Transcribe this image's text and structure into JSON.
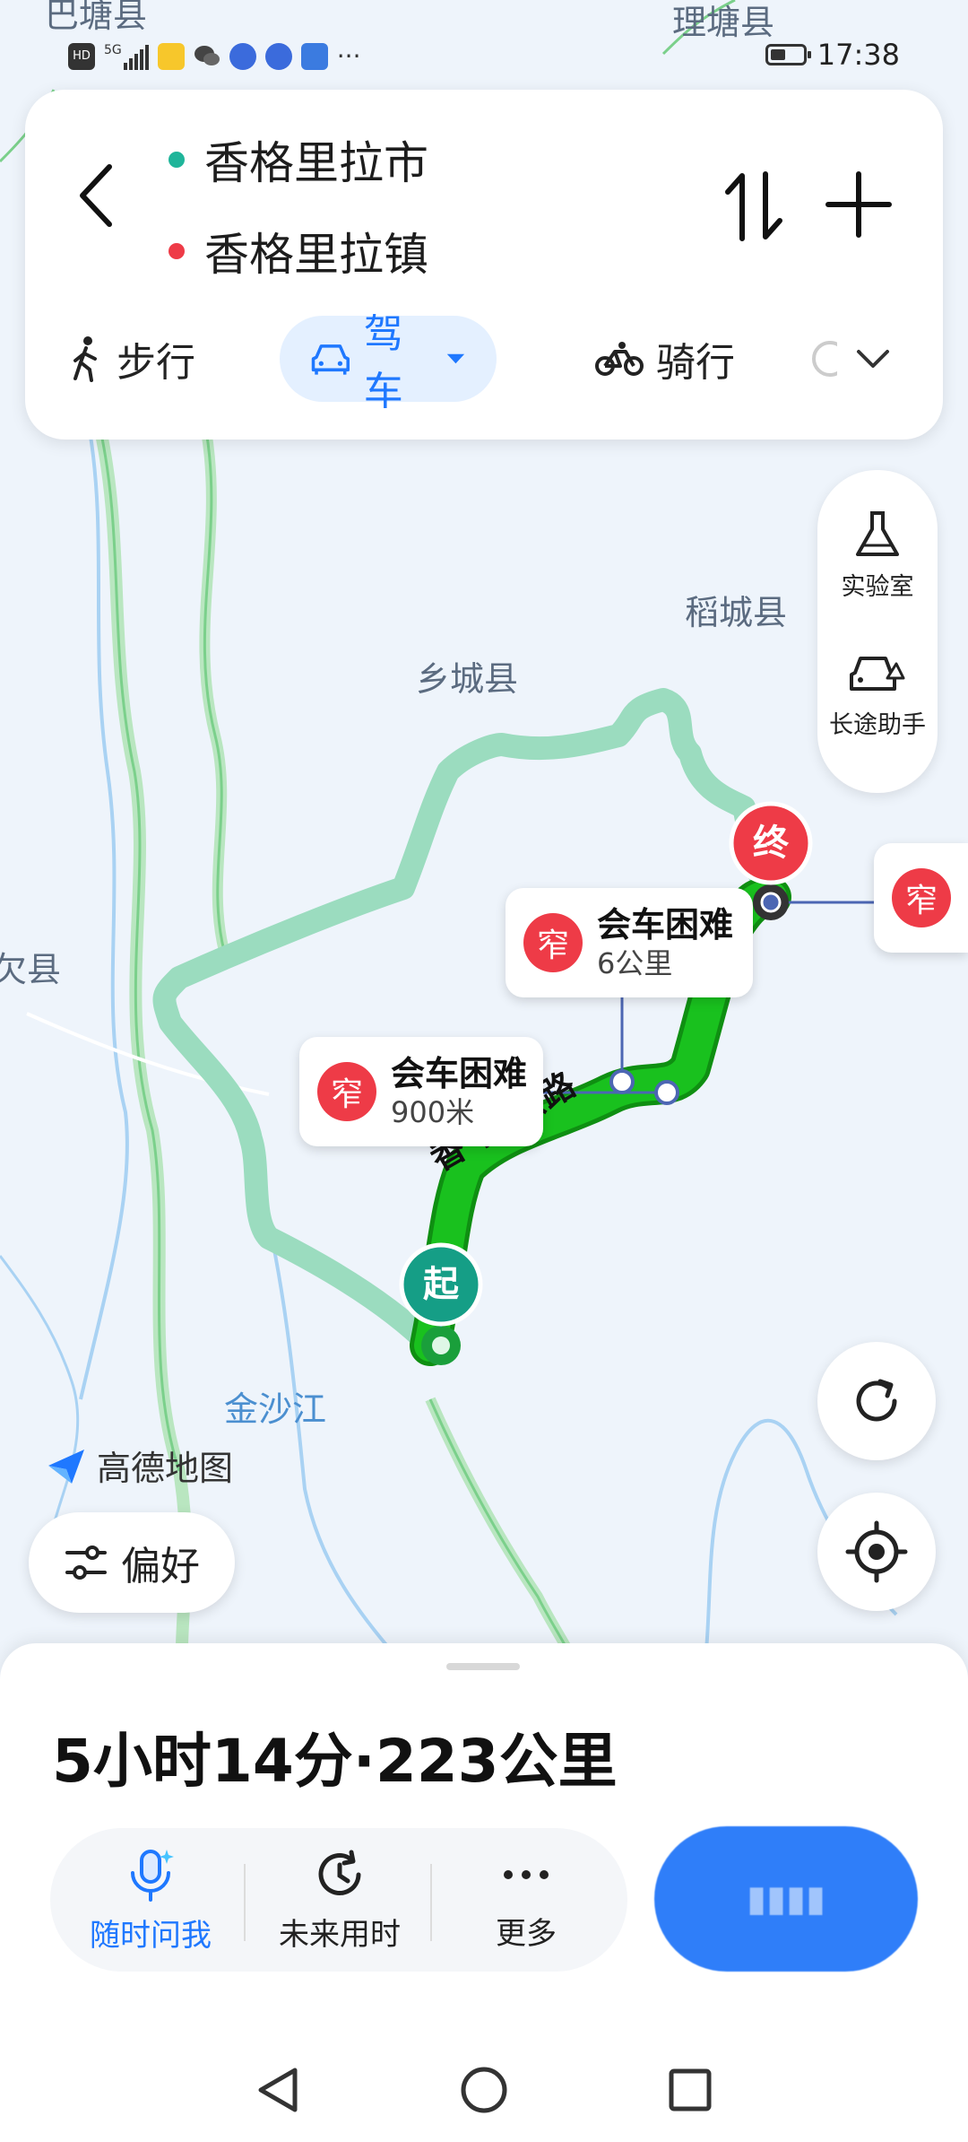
{
  "status_bar": {
    "time": "17:38",
    "network": "5G",
    "hd": "HD",
    "icons": [
      "meituan-icon",
      "wechat-icon",
      "browser-icon",
      "browser2-icon",
      "security-icon",
      "more-dots"
    ]
  },
  "route": {
    "start": "香格里拉市",
    "end": "香格里拉镇",
    "start_color": "#1fb59a",
    "end_color": "#ee3b47"
  },
  "modes": {
    "walk": "步行",
    "drive": "驾车",
    "ride": "骑行"
  },
  "side_tools": {
    "lab": "实验室",
    "long_trip": "长途助手"
  },
  "map": {
    "labels": {
      "batang": "巴塘县",
      "litang": "理塘县",
      "daocheng": "稻城县",
      "xiangcheng": "乡城县",
      "xian_left": "欠县",
      "jinshajiang": "金沙江",
      "road": "香 格 公路"
    },
    "start_marker": "起",
    "end_marker": "终",
    "brand": "高德地图",
    "warnings": [
      {
        "icon": "窄",
        "title": "会车困难",
        "distance": "6公里"
      },
      {
        "icon": "窄",
        "title": "会车困难",
        "distance": "900米"
      },
      {
        "icon": "窄",
        "title": "",
        "distance": ""
      }
    ]
  },
  "preference": "偏好",
  "summary": "5小时14分·223公里",
  "actions": {
    "voice": "随时问我",
    "future": "未来用时",
    "more": "更多"
  },
  "colors": {
    "accent": "#1f78ff",
    "route_green": "#17b51b",
    "alt_route": "#9bdcbf",
    "warn_red": "#ee3b47"
  }
}
